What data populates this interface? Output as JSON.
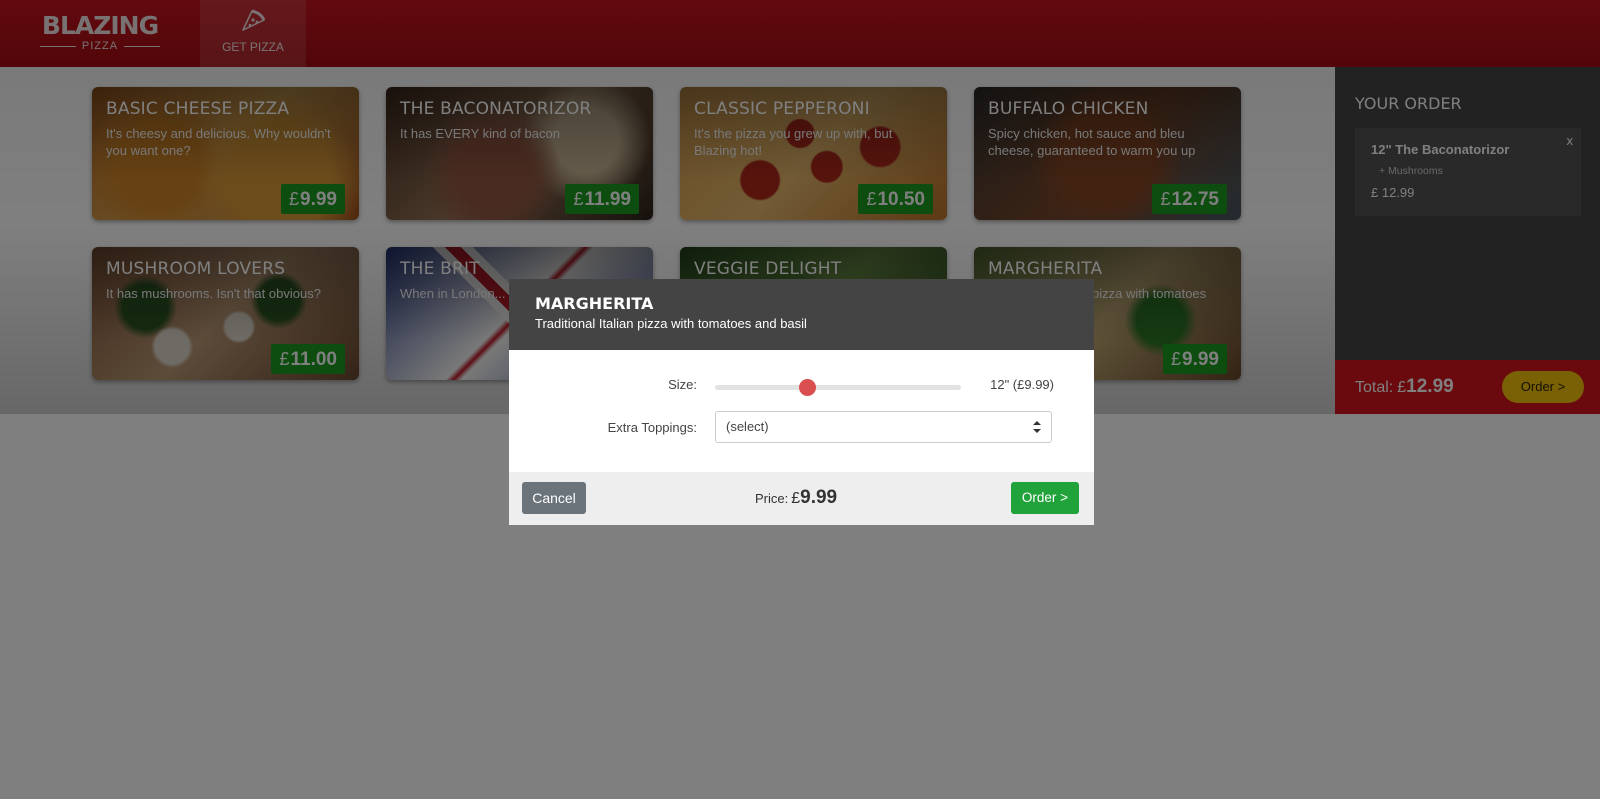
{
  "header": {
    "logo_main": "BLAZING",
    "logo_sub": "PIZZA",
    "nav_label": "GET PIZZA"
  },
  "pizzas": [
    {
      "name": "Basic Cheese Pizza",
      "description": "It's cheesy and delicious. Why wouldn't you want one?",
      "currency": "£",
      "price": "9.99"
    },
    {
      "name": "The Baconatorizor",
      "description": "It has EVERY kind of bacon",
      "currency": "£",
      "price": "11.99"
    },
    {
      "name": "Classic pepperoni",
      "description": "It's the pizza you grew up with, but Blazing hot!",
      "currency": "£",
      "price": "10.50"
    },
    {
      "name": "Buffalo chicken",
      "description": "Spicy chicken, hot sauce and bleu cheese, guaranteed to warm you up",
      "currency": "£",
      "price": "12.75"
    },
    {
      "name": "Mushroom Lovers",
      "description": "It has mushrooms. Isn't that obvious?",
      "currency": "£",
      "price": "11.00"
    },
    {
      "name": "The Brit",
      "description": "When in London...",
      "currency": "£",
      "price": ""
    },
    {
      "name": "Veggie Delight",
      "description": "",
      "currency": "£",
      "price": ""
    },
    {
      "name": "Margherita",
      "description": "pizza with tomatoes",
      "currency": "£",
      "price": "9.99"
    }
  ],
  "order": {
    "heading": "YOUR ORDER",
    "items": [
      {
        "title": "12\" The Baconatorizor",
        "topping": "+ Mushrooms",
        "price": "£ 12.99",
        "remove": "x"
      }
    ],
    "total_label": "Total:",
    "total_currency": "£",
    "total_amount": "12.99",
    "button": "Order >"
  },
  "dialog": {
    "title": "MARGHERITA",
    "subtitle": "Traditional Italian pizza with tomatoes and basil",
    "size_label": "Size:",
    "size_slider_fraction": 0.375,
    "size_value": "12\" (£9.99)",
    "toppings_label": "Extra Toppings:",
    "toppings_selected": "(select)",
    "cancel_label": "Cancel",
    "price_label": "Price:",
    "price_currency": "£",
    "price_amount": "9.99",
    "order_label": "Order >"
  },
  "colors": {
    "brand_red": "#c4141d",
    "price_green": "#1a9b1e",
    "order_yellow": "#f4c20d",
    "slider_thumb": "#d94f4f",
    "confirm_green": "#1fa33a"
  }
}
